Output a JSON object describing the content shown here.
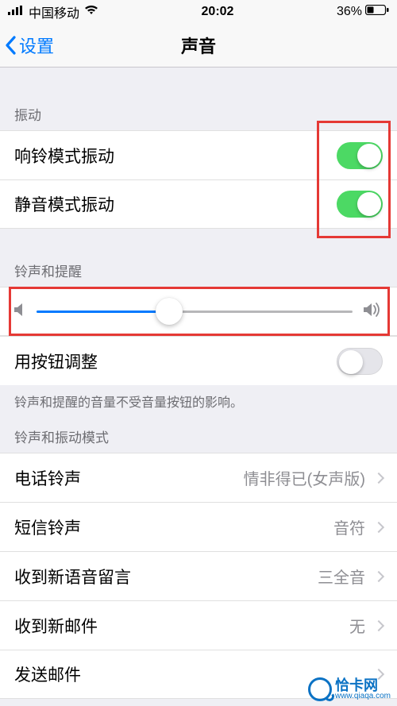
{
  "status": {
    "carrier": "中国移动",
    "time": "20:02",
    "battery": "36%"
  },
  "nav": {
    "back": "设置",
    "title": "声音"
  },
  "sections": {
    "vibration": {
      "header": "振动",
      "ring": {
        "label": "响铃模式振动",
        "on": true
      },
      "silent": {
        "label": "静音模式振动",
        "on": true
      }
    },
    "ringer": {
      "header": "铃声和提醒",
      "sliderValue": 0.42,
      "buttonAdjust": {
        "label": "用按钮调整",
        "on": false
      },
      "footer": "铃声和提醒的音量不受音量按钮的影响。"
    },
    "patterns": {
      "header": "铃声和振动模式",
      "items": [
        {
          "label": "电话铃声",
          "value": "情非得已(女声版)"
        },
        {
          "label": "短信铃声",
          "value": "音符"
        },
        {
          "label": "收到新语音留言",
          "value": "三全音"
        },
        {
          "label": "收到新邮件",
          "value": "无"
        },
        {
          "label": "发送邮件",
          "value": ""
        }
      ]
    }
  },
  "watermark": {
    "name": "恰卡网",
    "url": "www.qiaqa.com"
  }
}
